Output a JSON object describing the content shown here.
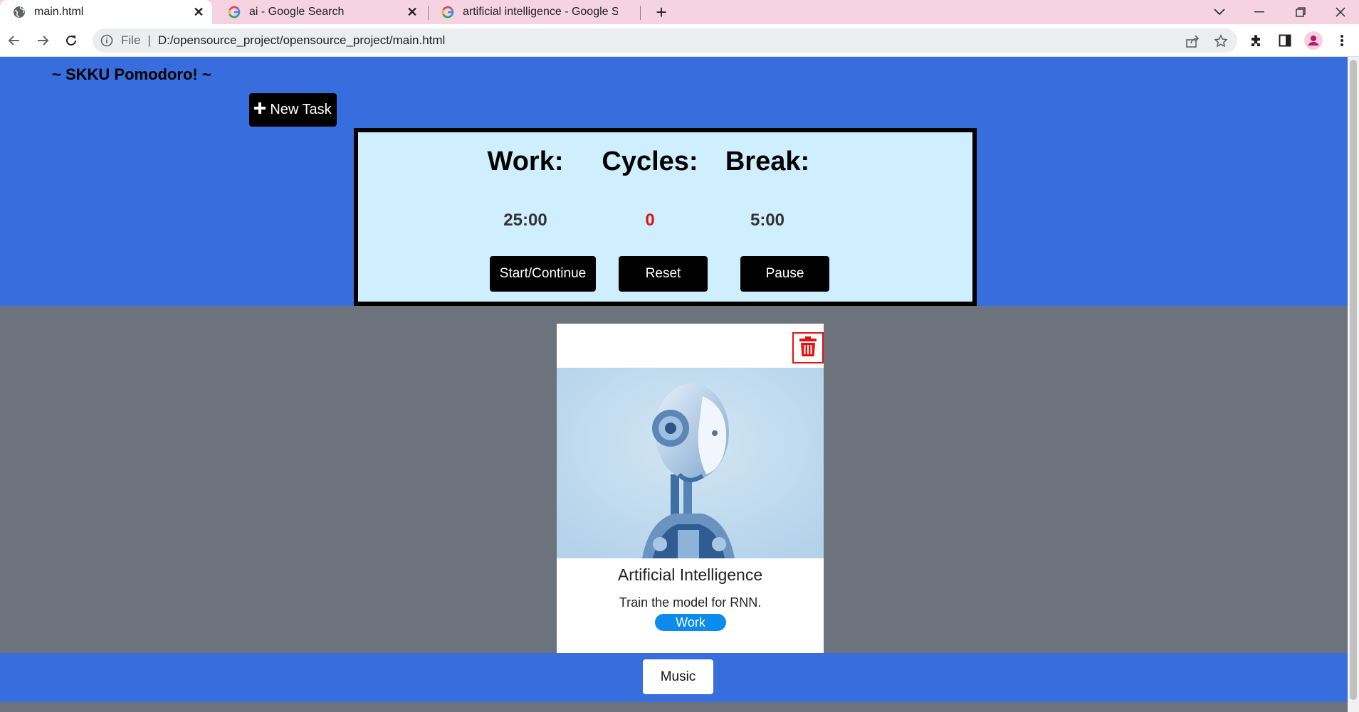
{
  "browser": {
    "tabs": [
      {
        "title": "main.html",
        "active": true
      },
      {
        "title": "ai - Google Search",
        "active": false
      },
      {
        "title": "artificial intelligence - Google Search",
        "active": false
      }
    ],
    "address": {
      "scheme": "File",
      "url": "D:/opensource_project/opensource_project/main.html"
    }
  },
  "header": {
    "title": "~ SKKU Pomodoro! ~",
    "new_task_label": "New Task"
  },
  "timer": {
    "work_label": "Work:",
    "cycles_label": "Cycles:",
    "break_label": "Break:",
    "work_value": "25:00",
    "cycles_value": "0",
    "break_value": "5:00",
    "start_label": "Start/Continue",
    "reset_label": "Reset",
    "pause_label": "Pause"
  },
  "task": {
    "title": "Artificial Intelligence",
    "description": "Train the model for RNN.",
    "tag": "Work"
  },
  "footer": {
    "music_label": "Music"
  },
  "colors": {
    "header_bg": "#376ddd",
    "page_bg": "#6c737c",
    "panel_bg": "#cfeefe",
    "cycles_red": "#e41212",
    "tag_blue": "#0d8bed"
  }
}
